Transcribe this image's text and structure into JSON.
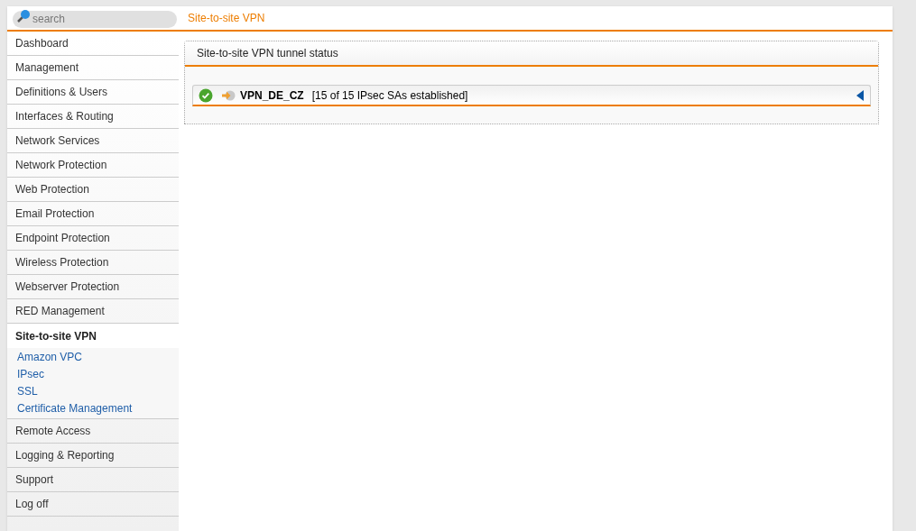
{
  "search": {
    "placeholder": "search"
  },
  "breadcrumb": "Site-to-site VPN",
  "sidebar": {
    "items": [
      {
        "label": "Dashboard",
        "expanded": false
      },
      {
        "label": "Management",
        "expanded": false
      },
      {
        "label": "Definitions & Users",
        "expanded": false
      },
      {
        "label": "Interfaces & Routing",
        "expanded": false
      },
      {
        "label": "Network Services",
        "expanded": false
      },
      {
        "label": "Network Protection",
        "expanded": false
      },
      {
        "label": "Web Protection",
        "expanded": false
      },
      {
        "label": "Email Protection",
        "expanded": false
      },
      {
        "label": "Endpoint Protection",
        "expanded": false
      },
      {
        "label": "Wireless Protection",
        "expanded": false
      },
      {
        "label": "Webserver Protection",
        "expanded": false
      },
      {
        "label": "RED Management",
        "expanded": false
      },
      {
        "label": "Site-to-site VPN",
        "expanded": true,
        "children": [
          {
            "label": "Amazon VPC"
          },
          {
            "label": "IPsec"
          },
          {
            "label": "SSL"
          },
          {
            "label": "Certificate Management"
          }
        ]
      },
      {
        "label": "Remote Access",
        "expanded": false
      },
      {
        "label": "Logging & Reporting",
        "expanded": false
      },
      {
        "label": "Support",
        "expanded": false
      },
      {
        "label": "Log off",
        "expanded": false
      }
    ]
  },
  "panel": {
    "title": "Site-to-site VPN tunnel status",
    "tunnels": [
      {
        "name": "VPN_DE_CZ",
        "status_text": "[15 of 15 IPsec SAs established]",
        "connected": true
      }
    ]
  }
}
